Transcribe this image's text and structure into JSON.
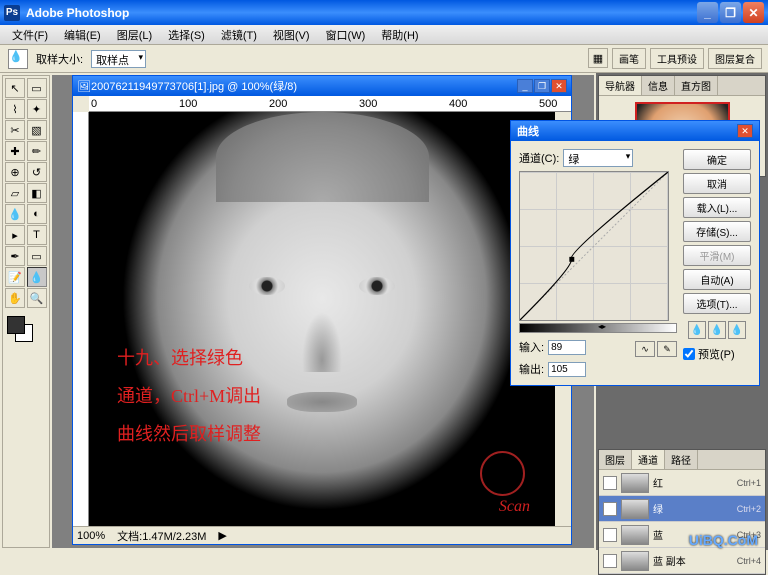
{
  "app": {
    "title": "Adobe Photoshop"
  },
  "menu": [
    "文件(F)",
    "编辑(E)",
    "图层(L)",
    "选择(S)",
    "滤镜(T)",
    "视图(V)",
    "窗口(W)",
    "帮助(H)"
  ],
  "optbar": {
    "sample_label": "取样大小:",
    "sample_value": "取样点"
  },
  "righttabs": [
    "画笔",
    "工具预设",
    "图层复合"
  ],
  "doc": {
    "title": "20076211949773706[1].jpg @ 100%(绿/8)",
    "zoom": "100%",
    "docsize": "文档:1.47M/2.23M"
  },
  "annotations": {
    "line1": "十九、选择绿色",
    "line2": "通道，Ctrl+M调出",
    "line3": "曲线然后取样调整",
    "sig": "Scan"
  },
  "ruler_h": [
    "0",
    "100",
    "200",
    "300",
    "400",
    "500"
  ],
  "navigator": {
    "tabs": [
      "导航器",
      "信息",
      "直方图"
    ]
  },
  "channels": {
    "tabs": [
      "图层",
      "通道",
      "路径"
    ],
    "rows": [
      {
        "name": "红",
        "key": "Ctrl+1"
      },
      {
        "name": "绿",
        "key": "Ctrl+2",
        "active": true,
        "eye": true
      },
      {
        "name": "蓝",
        "key": "Ctrl+3"
      },
      {
        "name": "蓝 副本",
        "key": "Ctrl+4"
      }
    ]
  },
  "curves": {
    "title": "曲线",
    "channel_label": "通道(C):",
    "channel_value": "绿",
    "input_label": "输入:",
    "input_value": "89",
    "output_label": "输出:",
    "output_value": "105",
    "buttons": {
      "ok": "确定",
      "cancel": "取消",
      "load": "载入(L)...",
      "save": "存储(S)...",
      "smooth": "平滑(M)",
      "auto": "自动(A)",
      "options": "选项(T)..."
    },
    "preview": "预览(P)"
  },
  "chart_data": {
    "type": "line",
    "title": "曲线 (绿通道)",
    "xlabel": "输入",
    "ylabel": "输出",
    "xlim": [
      0,
      255
    ],
    "ylim": [
      0,
      255
    ],
    "x": [
      0,
      89,
      255
    ],
    "values": [
      0,
      105,
      255
    ]
  },
  "watermark": "UiBQ.CoM"
}
